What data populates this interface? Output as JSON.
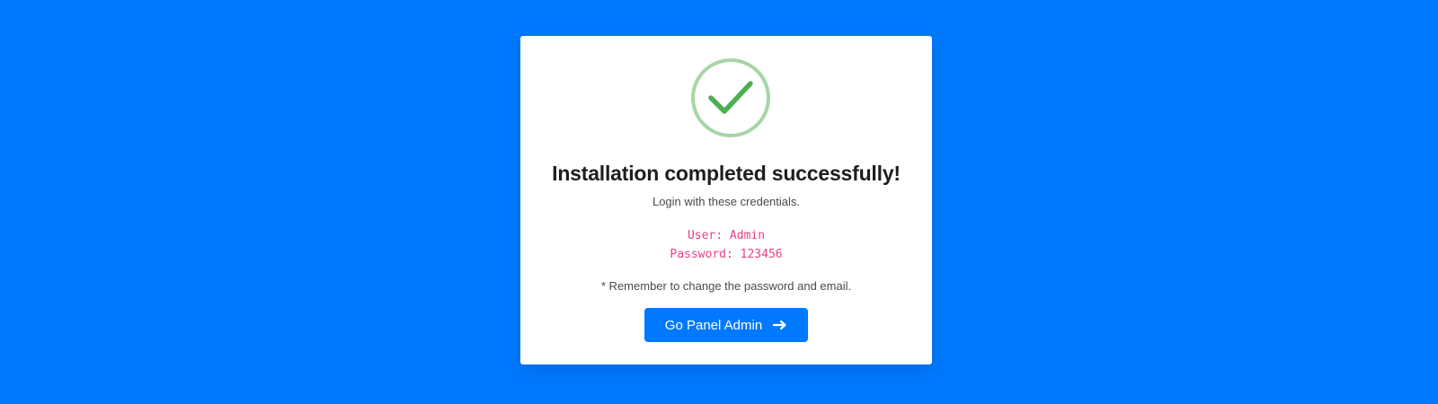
{
  "colors": {
    "page_background": "#0079fe",
    "card_background": "#ffffff",
    "success_green": "#4caf50",
    "success_ring": "#a5d6a7",
    "credentials_pink": "#e83e8c",
    "button_blue": "#0079fe"
  },
  "status_icon": "check-circle-icon",
  "title": "Installation completed successfully!",
  "subtitle": "Login with these credentials.",
  "credentials": {
    "user_line": "User: Admin",
    "password_line": "Password: 123456"
  },
  "note": "* Remember to change the password and email.",
  "button": {
    "label": "Go Panel Admin",
    "icon": "arrow-right-icon"
  }
}
